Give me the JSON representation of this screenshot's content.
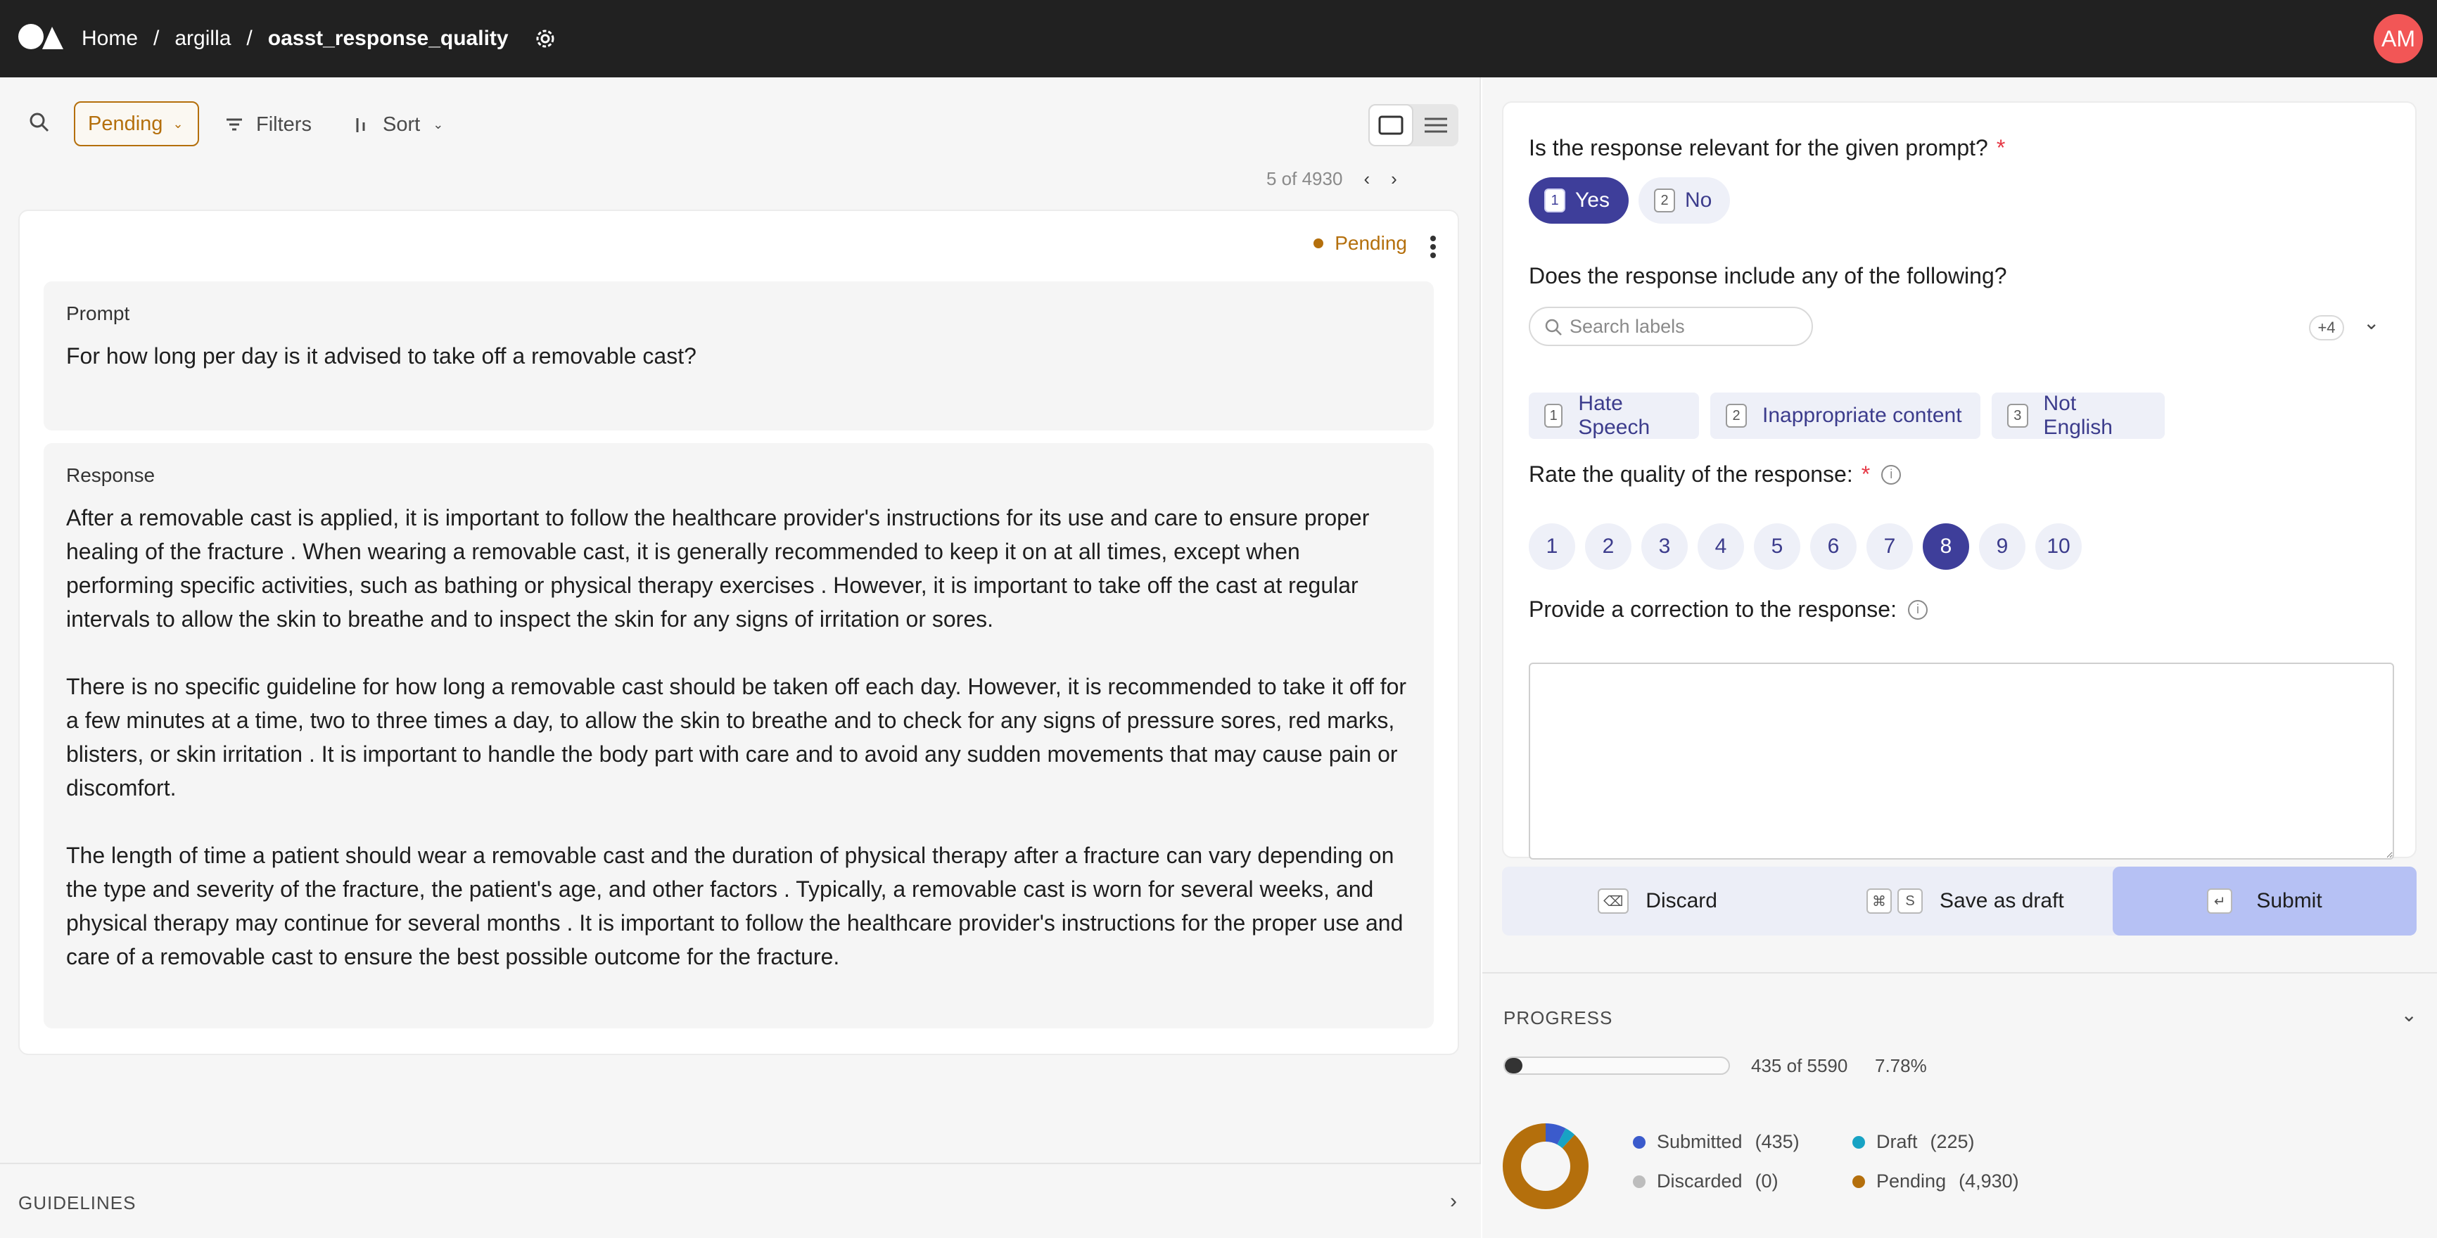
{
  "topbar": {
    "breadcrumbs": [
      "Home",
      "argilla",
      "oasst_response_quality"
    ],
    "separator": "/",
    "avatar_initials": "AM",
    "avatar_color": "#f25656"
  },
  "toolbar": {
    "status_filter": "Pending",
    "filters_label": "Filters",
    "sort_label": "Sort"
  },
  "pagination": {
    "text": "5 of 4930"
  },
  "record": {
    "status": "Pending",
    "fields": [
      {
        "title": "Prompt",
        "text": "For how long per day is it advised to take off a removable cast?"
      },
      {
        "title": "Response",
        "text": "After a removable cast is applied, it is important to follow the healthcare provider's instructions for its use and care to ensure proper healing of the fracture . When wearing a removable cast, it is generally recommended to keep it on at all times, except when performing specific activities, such as bathing or physical therapy exercises . However, it is important to take off the cast at regular intervals to allow the skin to breathe and to inspect the skin for any signs of irritation or sores.\n\nThere is no specific guideline for how long a removable cast should be taken off each day. However, it is recommended to take it off for a few minutes at a time, two to three times a day, to allow the skin to breathe and to check for any signs of pressure sores, red marks, blisters, or skin irritation . It is important to handle the body part with care and to avoid any sudden movements that may cause pain or discomfort.\n\nThe length of time a patient should wear a removable cast and the duration of physical therapy after a fracture can vary depending on the type and severity of the fracture, the patient's age, and other factors . Typically, a removable cast is worn for several weeks, and physical therapy may continue for several months . It is important to follow the healthcare provider's instructions for the proper use and care of a removable cast to ensure the best possible outcome for the fracture."
      }
    ]
  },
  "guidelines": {
    "label": "GUIDELINES"
  },
  "questions": {
    "relevance": {
      "title": "Is the response relevant for the given prompt?",
      "required_mark": "*",
      "options": [
        {
          "key": "1",
          "label": "Yes",
          "selected": true
        },
        {
          "key": "2",
          "label": "No",
          "selected": false
        }
      ]
    },
    "includes": {
      "title": "Does the response include any of the following?",
      "search_placeholder": "Search labels",
      "more_count": "+4",
      "options": [
        {
          "key": "1",
          "label": "Hate Speech"
        },
        {
          "key": "2",
          "label": "Inappropriate content"
        },
        {
          "key": "3",
          "label": "Not English"
        }
      ]
    },
    "quality": {
      "title": "Rate the quality of the response:",
      "required_mark": "*",
      "info": "i",
      "values": [
        "1",
        "2",
        "3",
        "4",
        "5",
        "6",
        "7",
        "8",
        "9",
        "10"
      ],
      "selected": "8"
    },
    "correction": {
      "title": "Provide a correction to the response:",
      "info": "i",
      "value": ""
    }
  },
  "actions": {
    "discard_label": "Discard",
    "discard_key": "⌫",
    "draft_label": "Save as draft",
    "draft_keys": [
      "⌘",
      "S"
    ],
    "submit_label": "Submit",
    "submit_key": "↵"
  },
  "progress": {
    "title": "PROGRESS",
    "count_text": "435 of 5590",
    "percent_text": "7.78%",
    "fraction": 0.0778,
    "legend": [
      {
        "label": "Submitted",
        "count": "(435)",
        "value": 435,
        "color": "#3b5bcc"
      },
      {
        "label": "Draft",
        "count": "(225)",
        "value": 225,
        "color": "#18a3c4"
      },
      {
        "label": "Discarded",
        "count": "(0)",
        "value": 0,
        "color": "#bdbdbd"
      },
      {
        "label": "Pending",
        "count": "(4,930)",
        "value": 4930,
        "color": "#b46f0c"
      }
    ]
  }
}
